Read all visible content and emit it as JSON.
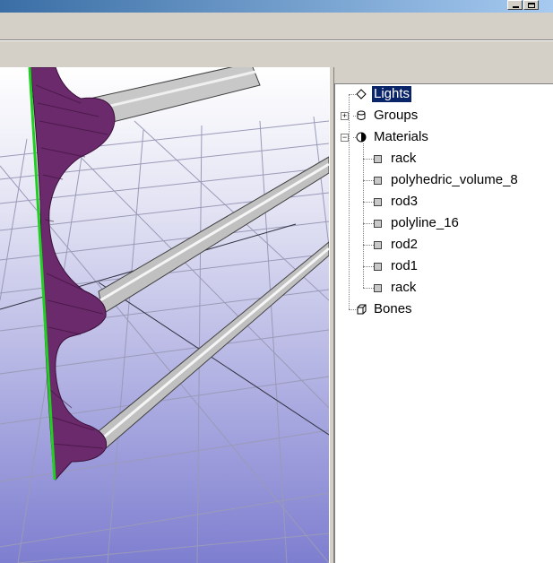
{
  "tree": {
    "lights": {
      "label": "Lights",
      "icon": "diamond-icon"
    },
    "groups": {
      "label": "Groups",
      "icon": "cylinder-icon"
    },
    "materials": {
      "label": "Materials",
      "icon": "sphere-icon",
      "items": [
        {
          "label": "rack"
        },
        {
          "label": "polyhedric_volume_8"
        },
        {
          "label": "rod3"
        },
        {
          "label": "polyline_16"
        },
        {
          "label": "rod2"
        },
        {
          "label": "rod1"
        },
        {
          "label": "rack"
        }
      ]
    },
    "bones": {
      "label": "Bones",
      "icon": "box-icon"
    }
  },
  "colors": {
    "viewport_top": "#ffffff",
    "viewport_bottom": "#7e7ed0",
    "rack": "#6b2a6b",
    "axis": "#20d020",
    "selection": "#0a246a"
  }
}
